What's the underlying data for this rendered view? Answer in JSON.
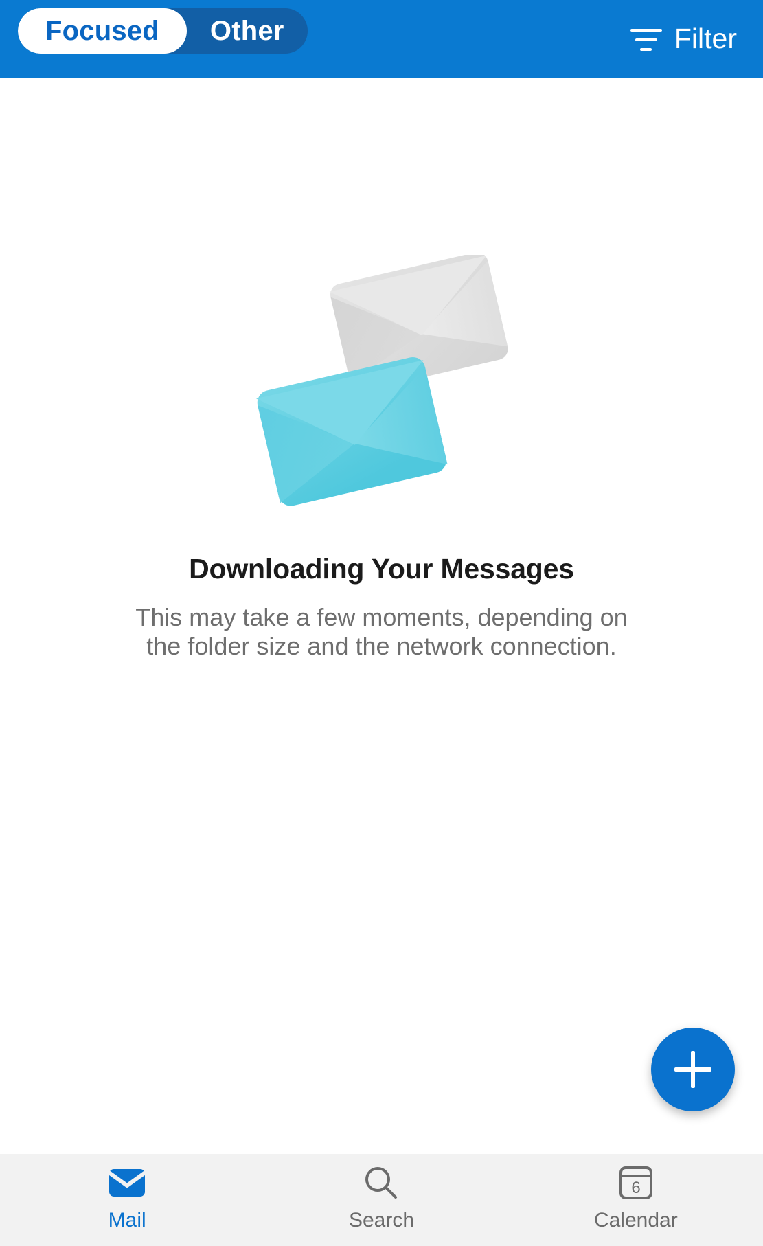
{
  "header": {
    "segmented": {
      "options": [
        {
          "label": "Focused",
          "selected": true
        },
        {
          "label": "Other",
          "selected": false
        }
      ]
    },
    "filter": {
      "label": "Filter",
      "icon": "filter-icon"
    },
    "background_color": "#0A7AD1",
    "segment_track_color": "#125FA6",
    "active_segment_text_color": "#0A66C2"
  },
  "main": {
    "illustration": {
      "name": "two-envelopes-illustration",
      "envelope_back_color": "#DCDCDC",
      "envelope_front_color": "#63D0E2"
    },
    "title": "Downloading Your Messages",
    "subtitle_line1": "This may take a few moments, depending on",
    "subtitle_line2": "the folder size and the network connection.",
    "subtitle": "This may take a few moments, depending on the folder size and the network connection."
  },
  "compose": {
    "label": "+",
    "icon": "plus-icon",
    "color": "#0A72CE"
  },
  "bottom_nav": {
    "background_color": "#F2F2F2",
    "active_color": "#0A72CE",
    "inactive_color": "#6B6B6B",
    "items": [
      {
        "label": "Mail",
        "icon": "mail-envelope-icon",
        "active": true
      },
      {
        "label": "Search",
        "icon": "search-magnifier-icon",
        "active": false
      },
      {
        "label": "Calendar",
        "icon": "calendar-icon",
        "active": false,
        "badge_day": "6"
      }
    ]
  }
}
